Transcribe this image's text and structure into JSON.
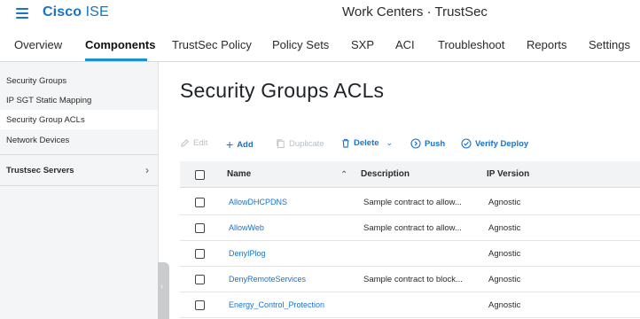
{
  "header": {
    "brand_bold": "Cisco",
    "brand_light": " ISE",
    "context_title": "Work Centers · TrustSec"
  },
  "tabs": [
    {
      "label": "Overview"
    },
    {
      "label": "Components"
    },
    {
      "label": "TrustSec Policy"
    },
    {
      "label": "Policy Sets"
    },
    {
      "label": "SXP"
    },
    {
      "label": "ACI"
    },
    {
      "label": "Troubleshoot"
    },
    {
      "label": "Reports"
    },
    {
      "label": "Settings"
    }
  ],
  "sidebar": {
    "items": [
      {
        "label": "Security Groups"
      },
      {
        "label": "IP SGT Static Mapping"
      },
      {
        "label": "Security Group ACLs"
      },
      {
        "label": "Network Devices"
      }
    ],
    "section": {
      "label": "Trustsec Servers",
      "icon": "chevron-right-icon"
    }
  },
  "main": {
    "title": "Security Groups ACLs",
    "toolbar": {
      "edit": "Edit",
      "add": "Add",
      "duplicate": "Duplicate",
      "delete": "Delete",
      "push": "Push",
      "verify": "Verify Deploy"
    },
    "table": {
      "columns": [
        "Name",
        "Description",
        "IP Version"
      ],
      "rows": [
        {
          "name": "AllowDHCPDNS",
          "description": "Sample contract to allow...",
          "ip_version": "Agnostic"
        },
        {
          "name": "AllowWeb",
          "description": "Sample contract to allow...",
          "ip_version": "Agnostic"
        },
        {
          "name": "DenyIPlog",
          "description": "",
          "ip_version": "Agnostic"
        },
        {
          "name": "DenyRemoteServices",
          "description": "Sample contract to block...",
          "ip_version": "Agnostic"
        },
        {
          "name": "Energy_Control_Protection",
          "description": "",
          "ip_version": "Agnostic"
        }
      ]
    }
  },
  "colors": {
    "accent": "#1a73c8",
    "tab_underline": "#1a8fd6",
    "disabled": "#b8bfc6"
  }
}
